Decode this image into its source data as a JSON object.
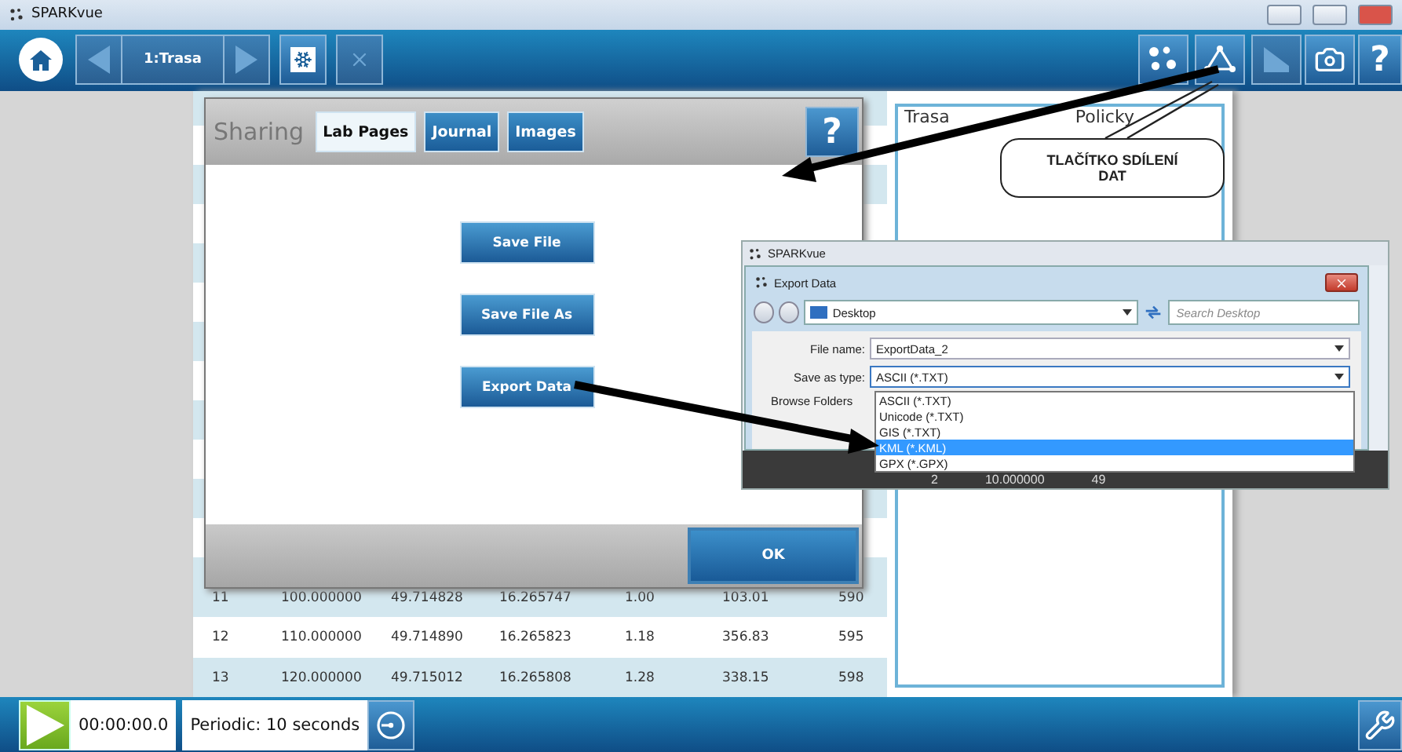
{
  "window": {
    "title": "SPARKvue"
  },
  "toolbar": {
    "page_label": "1:Trasa",
    "help": "?"
  },
  "page": {
    "note_title": [
      "Trasa",
      "Policky"
    ],
    "table_rows": [
      [
        "11",
        "100.000000",
        "49.714828",
        "16.265747",
        "1.00",
        "103.01",
        "590"
      ],
      [
        "12",
        "110.000000",
        "49.714890",
        "16.265823",
        "1.18",
        "356.83",
        "595"
      ],
      [
        "13",
        "120.000000",
        "49.715012",
        "16.265808",
        "1.28",
        "338.15",
        "598"
      ]
    ]
  },
  "sharing_dialog": {
    "title": "Sharing",
    "help": "?",
    "tabs": [
      {
        "label": "Lab Pages",
        "selected": true
      },
      {
        "label": "Journal",
        "selected": false
      },
      {
        "label": "Images",
        "selected": false
      }
    ],
    "actions": [
      "Save File",
      "Save File As",
      "Export Data"
    ],
    "ok": "OK"
  },
  "export_window": {
    "app_title": "SPARKvue",
    "title": "Export Data",
    "location": "Desktop",
    "search": {
      "placeholder": "Search Desktop"
    },
    "file_name_label": "File name:",
    "file_name": "ExportData_2",
    "type_label": "Save as type:",
    "type_value": "ASCII (*.TXT)",
    "type_options": [
      {
        "label": "ASCII (*.TXT)",
        "selected": false
      },
      {
        "label": "Unicode (*.TXT)",
        "selected": false
      },
      {
        "label": "GIS (*.TXT)",
        "selected": false
      },
      {
        "label": "KML (*.KML)",
        "selected": true
      },
      {
        "label": "GPX (*.GPX)",
        "selected": false
      }
    ],
    "browse": "Browse Folders",
    "behind_row": [
      "2",
      "10.000000",
      "49"
    ]
  },
  "callout": {
    "text": "TLAČÍTKO SDÍLENÍ DAT"
  },
  "status_bar": {
    "time": "00:00:00.0",
    "sampling": "Periodic: 10 seconds"
  }
}
